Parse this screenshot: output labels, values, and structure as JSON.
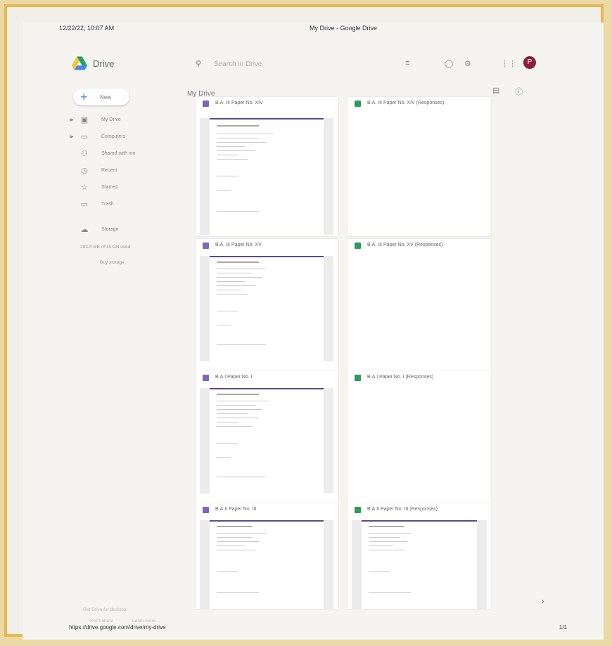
{
  "print": {
    "datetime": "12/22/22, 10:07 AM",
    "doc_title": "My Drive - Google Drive",
    "url": "https://drive.google.com/drive/my-drive",
    "page": "1/1"
  },
  "header": {
    "product": "Drive",
    "search_placeholder": "Search in Drive",
    "avatar_letter": "P"
  },
  "sidebar": {
    "new_label": "New",
    "items": [
      {
        "label": "My Drive",
        "icon": "my-drive-icon"
      },
      {
        "label": "Computers",
        "icon": "computer-icon"
      },
      {
        "label": "Shared with me",
        "icon": "shared-icon"
      },
      {
        "label": "Recent",
        "icon": "clock-icon"
      },
      {
        "label": "Starred",
        "icon": "star-icon"
      },
      {
        "label": "Trash",
        "icon": "trash-icon"
      }
    ],
    "storage_label": "Storage",
    "storage_used": "383.4 MB of 15 GB used",
    "buy_storage": "Buy storage",
    "get_drive": "Get Drive for desktop",
    "dont_show": "Don't show",
    "learn_more": "Learn more"
  },
  "main": {
    "title": "My Drive",
    "files": [
      {
        "name": "B.A. III Paper No. XIV",
        "type": "form"
      },
      {
        "name": "B.A. III Paper No. XIV (Responses)",
        "type": "sheet"
      },
      {
        "name": "B.A. III Paper No. XV",
        "type": "form"
      },
      {
        "name": "B.A. III Paper No. XV (Responses)",
        "type": "sheet"
      },
      {
        "name": "B.A.I Paper No. I",
        "type": "form"
      },
      {
        "name": "B.A.I Paper No. I (Responses)",
        "type": "sheet"
      },
      {
        "name": "B.A.II Paper No. III",
        "type": "form"
      },
      {
        "name": "B.A.II Paper No. III (Responses)",
        "type": "sheet"
      }
    ]
  },
  "colors": {
    "form": "#7b67b8",
    "sheet": "#2e9b5a",
    "frame": "#e9b84e",
    "avatar": "#8d1f3a"
  }
}
